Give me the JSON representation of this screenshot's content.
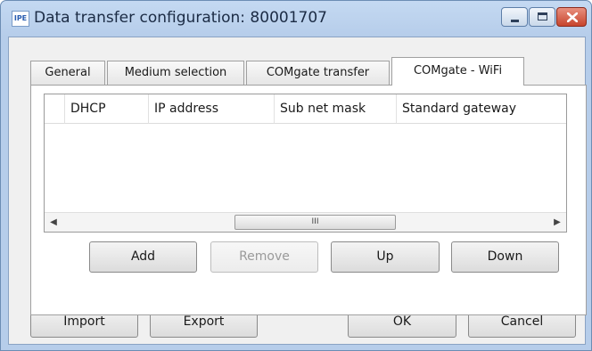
{
  "window": {
    "app_icon_text": "IPE",
    "title": "Data transfer configuration: 80001707",
    "controls": {
      "minimize": "minimize-icon",
      "maximize": "maximize-icon",
      "close": "close-icon"
    }
  },
  "tabs": [
    {
      "label": "General",
      "active": false
    },
    {
      "label": "Medium selection",
      "active": false
    },
    {
      "label": "COMgate transfer",
      "active": false
    },
    {
      "label": "COMgate - WiFi",
      "active": true
    }
  ],
  "grid": {
    "columns": [
      "",
      "DHCP",
      "IP address",
      "Sub net mask",
      "Standard gateway"
    ],
    "rows": [],
    "scrollbar": {
      "left_icon": "scroll-left-icon",
      "right_icon": "scroll-right-icon",
      "thumb_grip": "III"
    }
  },
  "panel_buttons": {
    "add": "Add",
    "remove": "Remove",
    "up": "Up",
    "down": "Down"
  },
  "footer_buttons": {
    "import": "Import",
    "export": "Export",
    "ok": "OK",
    "cancel": "Cancel"
  },
  "colors": {
    "title_bar": "#c4d9f2",
    "close_button": "#c7452d",
    "dialog_body": "#f0f0f0"
  }
}
